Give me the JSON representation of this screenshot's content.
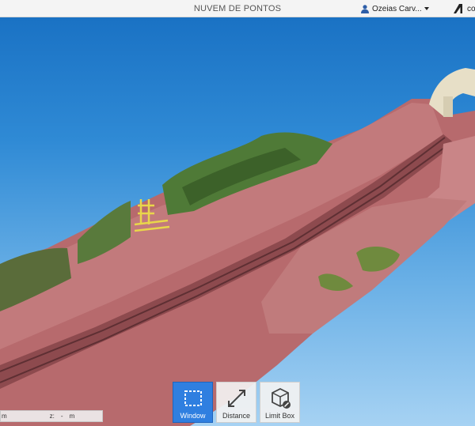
{
  "header": {
    "title": "NUVEM DE PONTOS",
    "user_name": "Ozeias Carv...",
    "brand_text": "co"
  },
  "toolbar": {
    "tools": [
      {
        "label": "Window",
        "icon": "selection-window-icon",
        "active": true
      },
      {
        "label": "Distance",
        "icon": "distance-measure-icon",
        "active": false
      },
      {
        "label": "Limit Box",
        "icon": "limit-box-icon",
        "active": false
      }
    ]
  },
  "coordinates": {
    "unit_1": "m",
    "z_label": "z:",
    "z_value": "-",
    "unit_2": "m"
  },
  "colors": {
    "accent": "#2f7fe0",
    "sky_top": "#1a72c4",
    "sky_bottom": "#a6d2f3",
    "terrain": "#b5676a",
    "vegetation": "#4f7a37",
    "rail_marker": "#e9d64a"
  }
}
